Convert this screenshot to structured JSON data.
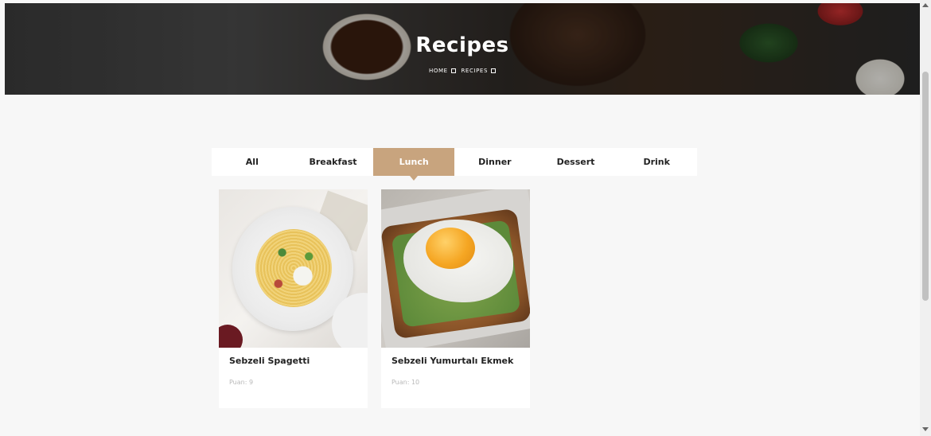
{
  "hero": {
    "title": "Recipes",
    "breadcrumb": [
      {
        "label": "HOME"
      },
      {
        "label": "RECIPES"
      }
    ]
  },
  "tabs": [
    {
      "label": "All",
      "active": false
    },
    {
      "label": "Breakfast",
      "active": false
    },
    {
      "label": "Lunch",
      "active": true
    },
    {
      "label": "Dinner",
      "active": false
    },
    {
      "label": "Dessert",
      "active": false
    },
    {
      "label": "Drink",
      "active": false
    }
  ],
  "colors": {
    "accent": "#c8a47e",
    "background": "#f7f7f7"
  },
  "recipes": [
    {
      "title": "Sebzeli Spagetti",
      "meta": "Puan: 9"
    },
    {
      "title": "Sebzeli Yumurtalı Ekmek",
      "meta": "Puan: 10"
    }
  ]
}
